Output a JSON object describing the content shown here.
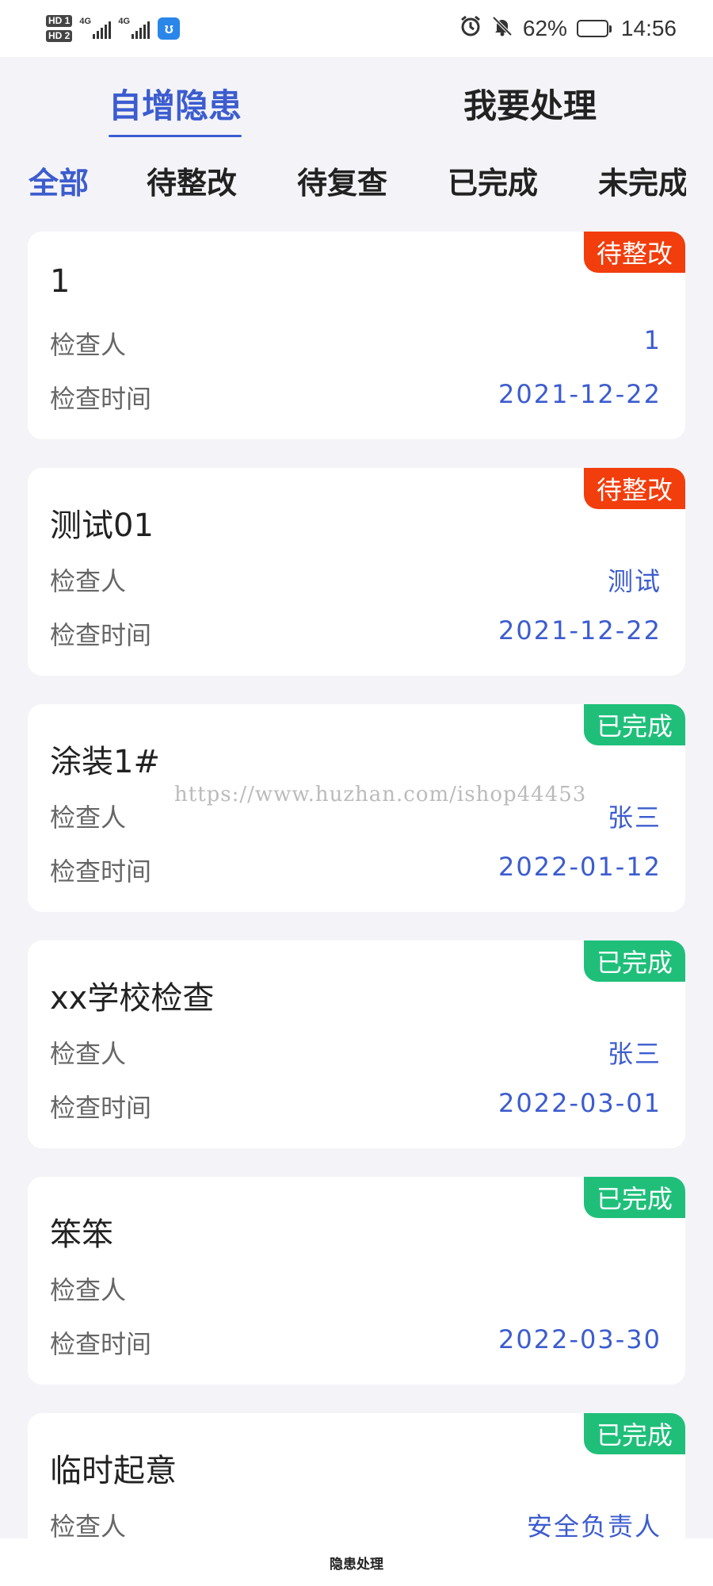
{
  "status_bar": {
    "network_left": "HD 1",
    "network_right": "HD 2",
    "signal1": "4G",
    "signal2": "4G",
    "app_icon_glyph": "ʊ",
    "battery": "62%",
    "battery_level": 0.62,
    "time": "14:56"
  },
  "main_tabs": [
    {
      "label": "自增隐患",
      "active": true
    },
    {
      "label": "我要处理",
      "active": false
    }
  ],
  "filter_tabs": [
    {
      "label": "全部",
      "active": true
    },
    {
      "label": "待整改",
      "active": false
    },
    {
      "label": "待复查",
      "active": false
    },
    {
      "label": "已完成",
      "active": false
    },
    {
      "label": "未完成",
      "active": false
    }
  ],
  "colors": {
    "accent": "#3c5ccf",
    "pending": "#f23d0c",
    "done": "#1fbf7a"
  },
  "field_labels": {
    "inspector": "检查人",
    "time": "检查时间"
  },
  "cards": [
    {
      "title": "1",
      "status": "待整改",
      "status_type": "pending",
      "inspector": "1",
      "time": "2021-12-22"
    },
    {
      "title": "测试01",
      "status": "待整改",
      "status_type": "pending",
      "inspector": "测试",
      "time": "2021-12-22"
    },
    {
      "title": "涂装1#",
      "status": "已完成",
      "status_type": "done",
      "inspector": "张三",
      "time": "2022-01-12"
    },
    {
      "title": "xx学校检查",
      "status": "已完成",
      "status_type": "done",
      "inspector": "张三",
      "time": "2022-03-01"
    },
    {
      "title": "笨笨",
      "status": "已完成",
      "status_type": "done",
      "inspector": "",
      "time": "2022-03-30"
    },
    {
      "title": "临时起意",
      "status": "已完成",
      "status_type": "done",
      "inspector": "安全负责人",
      "time": ""
    }
  ],
  "watermark": "https://www.huzhan.com/ishop44453",
  "bottom_bar": {
    "title": "隐患处理"
  }
}
